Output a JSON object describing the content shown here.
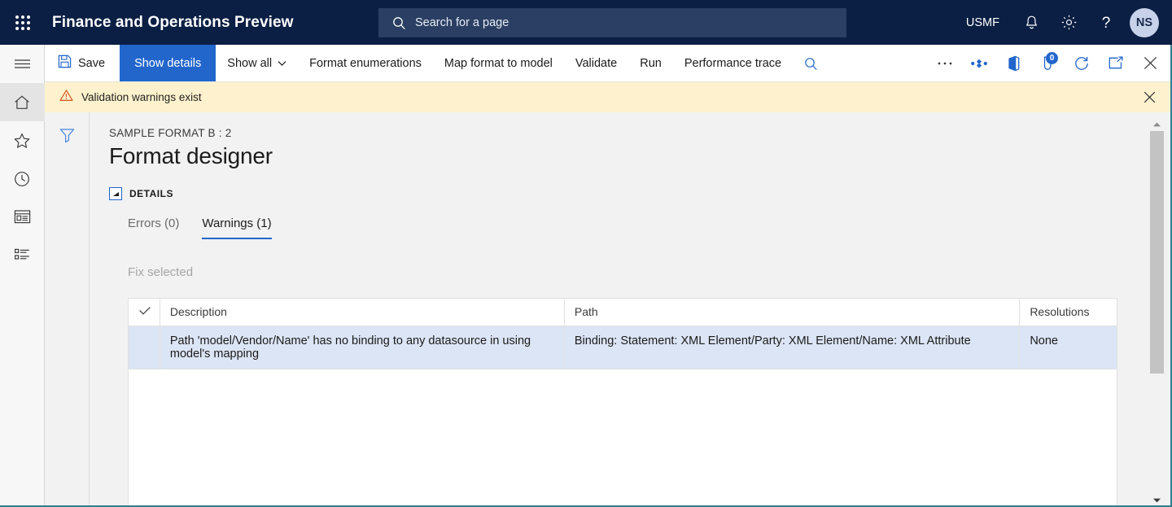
{
  "topbar": {
    "waffle_label": "app-launcher",
    "app_title": "Finance and Operations Preview",
    "search_placeholder": "Search for a page",
    "legal_entity": "USMF",
    "notifications_label": "notifications",
    "settings_label": "settings",
    "help_label": "help",
    "avatar_initials": "NS"
  },
  "rail": {
    "items": [
      {
        "name": "hamburger",
        "label": "Expand the navigation pane"
      },
      {
        "name": "home",
        "label": "Home"
      },
      {
        "name": "favorites",
        "label": "Favorites"
      },
      {
        "name": "recent",
        "label": "Recent"
      },
      {
        "name": "workspaces",
        "label": "Workspaces"
      },
      {
        "name": "modules",
        "label": "Modules"
      }
    ]
  },
  "commandbar": {
    "save": "Save",
    "show_details": "Show details",
    "show_all": "Show all",
    "format_enumerations": "Format enumerations",
    "map_format_to_model": "Map format to model",
    "validate": "Validate",
    "run": "Run",
    "performance_trace": "Performance trace",
    "search_label": "Search",
    "overflow_label": "More options",
    "attach_label": "Attachments",
    "office_label": "Open in Microsoft Office",
    "notes_badge": "0",
    "notes_label": "Notes",
    "refresh_label": "Refresh",
    "popout_label": "Open in new window",
    "close_label": "Close"
  },
  "messagebar": {
    "icon": "warning-triangle-icon",
    "text": "Validation warnings exist",
    "close_label": "Close message bar"
  },
  "filterpane": {
    "filter_label": "Show filter pane"
  },
  "page": {
    "caption": "SAMPLE FORMAT B : 2",
    "title": "Format designer",
    "section_label": "DETAILS",
    "collapse_label": "Collapse details"
  },
  "tabs": [
    {
      "label": "Errors (0)",
      "active": false,
      "name": "tab-errors"
    },
    {
      "label": "Warnings (1)",
      "active": true,
      "name": "tab-warnings"
    }
  ],
  "actions": {
    "fix_selected": "Fix selected"
  },
  "grid": {
    "columns": {
      "check": "✓",
      "description": "Description",
      "path": "Path",
      "resolutions": "Resolutions"
    },
    "rows": [
      {
        "selected": true,
        "description": "Path 'model/Vendor/Name' has no binding to any datasource in using model's mapping",
        "path": "Binding: Statement: XML Element/Party: XML Element/Name: XML Attribute",
        "resolutions": "None"
      }
    ]
  },
  "scrollbar": {
    "up_label": "Scroll up",
    "down_label": "Scroll down",
    "thumb_label": "Vertical scrollbar"
  },
  "colors": {
    "nav_bg": "#0b1f44",
    "accent": "#2266cc",
    "warning_bg": "#fdf2cd",
    "row_selected": "#dce5f5",
    "page_bg": "#f2f2f2",
    "edge": "#2e7f91"
  }
}
